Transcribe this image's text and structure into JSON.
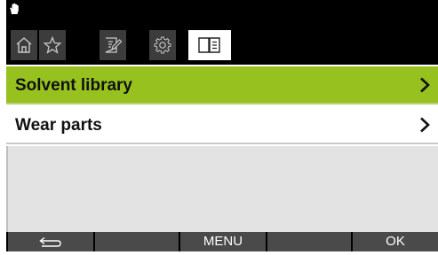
{
  "status_bar": {
    "icon": "hand-icon"
  },
  "tabs": [
    {
      "icon": "home-icon",
      "active": false
    },
    {
      "icon": "star-icon",
      "active": false
    },
    {
      "icon": "edit-icon",
      "active": false
    },
    {
      "icon": "gear-icon",
      "active": false
    },
    {
      "icon": "book-icon",
      "active": true
    }
  ],
  "menu": {
    "items": [
      {
        "label": "Solvent library",
        "selected": true
      },
      {
        "label": "Wear parts",
        "selected": false
      }
    ]
  },
  "softkeys": {
    "back_icon": "back-arrow-icon",
    "key2": "",
    "menu": "MENU",
    "key4": "",
    "ok": "OK"
  },
  "colors": {
    "selected_row": "#96c11f",
    "bars": "#000000",
    "softkey_bg": "#4a4a4a",
    "tab_bg": "#3c3c3c"
  }
}
